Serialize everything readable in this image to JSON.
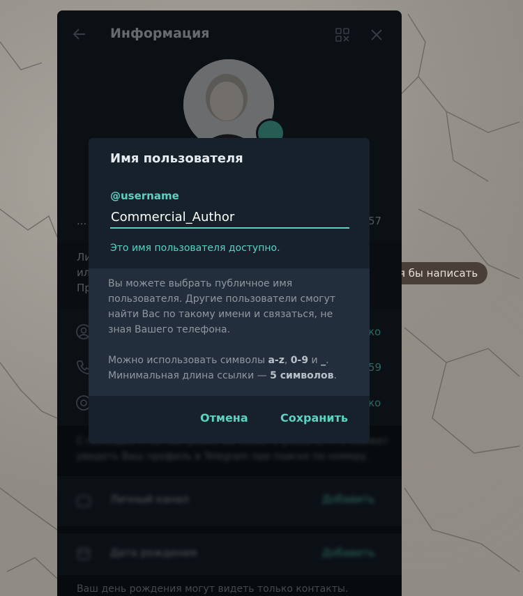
{
  "background": {
    "chat_bubble": "я бы написать"
  },
  "panel": {
    "header_title": "Информация",
    "name_row_ellipsis": "...",
    "name_row_tail": "57",
    "bio_lines": [
      "Ли",
      "ил",
      "Пр"
    ],
    "bio_tail_top": "а",
    "rows": [
      {
        "icon": "user-icon",
        "tail": "ко"
      },
      {
        "icon": "phone-icon",
        "tail": "59"
      },
      {
        "icon": "at-icon",
        "tail": "ко"
      }
    ],
    "note_lines": [
      "С помощью этой настройки вы можете указать, кто сможет",
      "увидеть Ваш профиль в Telegram при поиске по номеру."
    ],
    "channel_label": "Личный канал",
    "channel_action": "Добавить",
    "birthday_label": "Дата рождения",
    "birthday_action": "Добавить",
    "birthday_note": "Ваш день рождения могут видеть только контакты."
  },
  "dialog": {
    "title": "Имя пользователя",
    "field_label": "@username",
    "field_value": "Commercial_Author",
    "status": "Это имя пользователя доступно.",
    "hint_p1": "Вы можете выбрать публичное имя пользователя. Другие пользователи смогут найти Вас по такому имени и связаться, не зная Вашего телефона.",
    "hint_p2_prefix": "Можно использовать символы ",
    "hint_p2_chars1": "a-z",
    "hint_p2_sep1": ", ",
    "hint_p2_chars2": "0-9",
    "hint_p2_sep2": " и ",
    "hint_p2_chars3": "_",
    "hint_p2_sep3": ".",
    "hint_p3_prefix": "Минимальная длина ссылки — ",
    "hint_p3_bold": "5 символов",
    "hint_p3_suffix": ".",
    "cancel_label": "Отмена",
    "save_label": "Сохранить"
  },
  "colors": {
    "accent": "#5ad3c3",
    "panel_bg": "#17212b",
    "hint_bg": "#232e3c"
  }
}
